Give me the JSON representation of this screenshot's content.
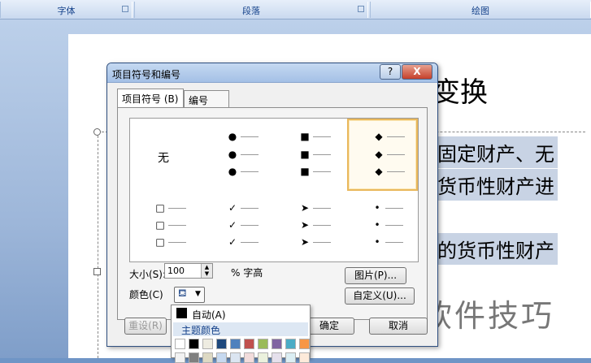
{
  "ribbon": {
    "groups": [
      {
        "label": "字体"
      },
      {
        "label": "段落"
      },
      {
        "label": "绘图"
      }
    ]
  },
  "document": {
    "title_fragment": "变换",
    "lines": [
      "固定财产、无",
      "货币性财产进",
      "的货币性财产"
    ]
  },
  "watermark": "软件技巧",
  "dialog": {
    "title": "项目符号和编号",
    "help_label": "?",
    "close_label": "X",
    "tabs": [
      {
        "label": "项目符号 (B)"
      },
      {
        "label": "编号 (N)"
      }
    ],
    "gallery": {
      "none_label": "无",
      "selected": "diamond"
    },
    "size_label": "大小(S):",
    "size_value": "100",
    "size_unit": "% 字高",
    "color_label": "颜色(C)",
    "picture_button": "图片(P)...",
    "custom_button": "自定义(U)...",
    "reset_button": "重设(R)",
    "ok_button": "确定",
    "cancel_button": "取消"
  },
  "color_popup": {
    "auto_label": "自动(A)",
    "theme_colors_label": "主题颜色",
    "swatches": [
      "#ffffff",
      "#000000",
      "#eeece1",
      "#1f497d",
      "#4f81bd",
      "#c0504d",
      "#9bbb59",
      "#8064a2",
      "#4bacc6",
      "#f79646"
    ],
    "swatches_row2": [
      "#f2f2f2",
      "#7f7f7f",
      "#ddd9c3",
      "#c6d9f0",
      "#dbe5f1",
      "#f2dcdb",
      "#ebf1dd",
      "#e5e0ec",
      "#dbeef3",
      "#fdeada"
    ]
  }
}
